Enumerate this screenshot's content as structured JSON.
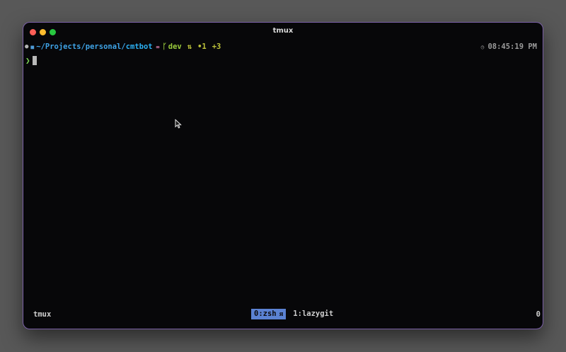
{
  "window": {
    "title": "tmux"
  },
  "prompt": {
    "apple_icon": "apple-icon",
    "folder_icon": "folder-icon",
    "path_prefix": "~/Projects/personal/",
    "path_current": "cmtbot",
    "link_icon": "link-icon",
    "branch_icon": "branch-icon",
    "branch": "dev",
    "sync_icon": "sync-icon",
    "dirty": "•1",
    "staged": "+3",
    "clock_icon": "clock-icon",
    "time": "08:45:19 PM",
    "caret": "❯"
  },
  "statusbar": {
    "session": "tmux",
    "windows": [
      {
        "label": "0:zsh",
        "flag": "ᴙ",
        "active": true
      },
      {
        "label": "1:lazygit",
        "active": false
      }
    ],
    "right": "0"
  },
  "colors": {
    "background": "#070709",
    "border": "#7a5fa6",
    "path": "#3fa4e8",
    "branch": "#9acb3c",
    "git_status": "#bfc43a",
    "caret": "#7ed957",
    "active_window": "#5b82d3"
  }
}
